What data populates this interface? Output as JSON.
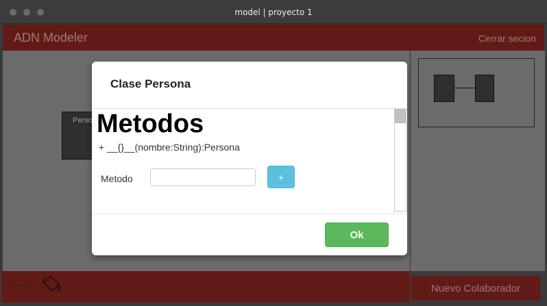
{
  "window": {
    "title": "model | proyecto 1"
  },
  "appbar": {
    "brand": "ADN Modeler",
    "logout_label": "Cerrar secion"
  },
  "canvas": {
    "node_label": "Perso"
  },
  "bottom": {
    "new_collaborator_label": "Nuevo Colaborador"
  },
  "modal": {
    "title": "Clase Persona",
    "section_heading": "Metodos",
    "methods": [
      "+ __{}__(nombre:String):Persona"
    ],
    "field_label": "Metodo",
    "field_value": "",
    "field_placeholder": "",
    "add_label": "+",
    "ok_label": "Ok"
  },
  "colors": {
    "accent_dark_red": "#621a16",
    "info_blue": "#5bc0de",
    "success_green": "#5cb85c"
  },
  "icons": {
    "paint_bucket": "paint-bucket-icon",
    "line_tool": "line-icon"
  }
}
